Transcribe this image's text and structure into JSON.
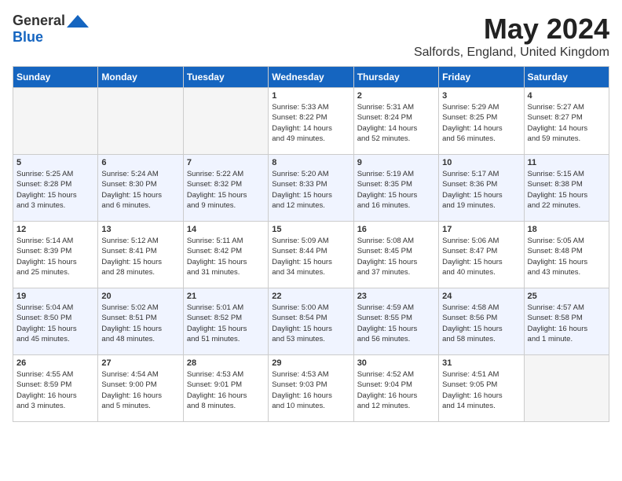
{
  "header": {
    "logo_general": "General",
    "logo_blue": "Blue",
    "month": "May 2024",
    "location": "Salfords, England, United Kingdom"
  },
  "days_of_week": [
    "Sunday",
    "Monday",
    "Tuesday",
    "Wednesday",
    "Thursday",
    "Friday",
    "Saturday"
  ],
  "weeks": [
    [
      {
        "day": "",
        "info": ""
      },
      {
        "day": "",
        "info": ""
      },
      {
        "day": "",
        "info": ""
      },
      {
        "day": "1",
        "info": "Sunrise: 5:33 AM\nSunset: 8:22 PM\nDaylight: 14 hours\nand 49 minutes."
      },
      {
        "day": "2",
        "info": "Sunrise: 5:31 AM\nSunset: 8:24 PM\nDaylight: 14 hours\nand 52 minutes."
      },
      {
        "day": "3",
        "info": "Sunrise: 5:29 AM\nSunset: 8:25 PM\nDaylight: 14 hours\nand 56 minutes."
      },
      {
        "day": "4",
        "info": "Sunrise: 5:27 AM\nSunset: 8:27 PM\nDaylight: 14 hours\nand 59 minutes."
      }
    ],
    [
      {
        "day": "5",
        "info": "Sunrise: 5:25 AM\nSunset: 8:28 PM\nDaylight: 15 hours\nand 3 minutes."
      },
      {
        "day": "6",
        "info": "Sunrise: 5:24 AM\nSunset: 8:30 PM\nDaylight: 15 hours\nand 6 minutes."
      },
      {
        "day": "7",
        "info": "Sunrise: 5:22 AM\nSunset: 8:32 PM\nDaylight: 15 hours\nand 9 minutes."
      },
      {
        "day": "8",
        "info": "Sunrise: 5:20 AM\nSunset: 8:33 PM\nDaylight: 15 hours\nand 12 minutes."
      },
      {
        "day": "9",
        "info": "Sunrise: 5:19 AM\nSunset: 8:35 PM\nDaylight: 15 hours\nand 16 minutes."
      },
      {
        "day": "10",
        "info": "Sunrise: 5:17 AM\nSunset: 8:36 PM\nDaylight: 15 hours\nand 19 minutes."
      },
      {
        "day": "11",
        "info": "Sunrise: 5:15 AM\nSunset: 8:38 PM\nDaylight: 15 hours\nand 22 minutes."
      }
    ],
    [
      {
        "day": "12",
        "info": "Sunrise: 5:14 AM\nSunset: 8:39 PM\nDaylight: 15 hours\nand 25 minutes."
      },
      {
        "day": "13",
        "info": "Sunrise: 5:12 AM\nSunset: 8:41 PM\nDaylight: 15 hours\nand 28 minutes."
      },
      {
        "day": "14",
        "info": "Sunrise: 5:11 AM\nSunset: 8:42 PM\nDaylight: 15 hours\nand 31 minutes."
      },
      {
        "day": "15",
        "info": "Sunrise: 5:09 AM\nSunset: 8:44 PM\nDaylight: 15 hours\nand 34 minutes."
      },
      {
        "day": "16",
        "info": "Sunrise: 5:08 AM\nSunset: 8:45 PM\nDaylight: 15 hours\nand 37 minutes."
      },
      {
        "day": "17",
        "info": "Sunrise: 5:06 AM\nSunset: 8:47 PM\nDaylight: 15 hours\nand 40 minutes."
      },
      {
        "day": "18",
        "info": "Sunrise: 5:05 AM\nSunset: 8:48 PM\nDaylight: 15 hours\nand 43 minutes."
      }
    ],
    [
      {
        "day": "19",
        "info": "Sunrise: 5:04 AM\nSunset: 8:50 PM\nDaylight: 15 hours\nand 45 minutes."
      },
      {
        "day": "20",
        "info": "Sunrise: 5:02 AM\nSunset: 8:51 PM\nDaylight: 15 hours\nand 48 minutes."
      },
      {
        "day": "21",
        "info": "Sunrise: 5:01 AM\nSunset: 8:52 PM\nDaylight: 15 hours\nand 51 minutes."
      },
      {
        "day": "22",
        "info": "Sunrise: 5:00 AM\nSunset: 8:54 PM\nDaylight: 15 hours\nand 53 minutes."
      },
      {
        "day": "23",
        "info": "Sunrise: 4:59 AM\nSunset: 8:55 PM\nDaylight: 15 hours\nand 56 minutes."
      },
      {
        "day": "24",
        "info": "Sunrise: 4:58 AM\nSunset: 8:56 PM\nDaylight: 15 hours\nand 58 minutes."
      },
      {
        "day": "25",
        "info": "Sunrise: 4:57 AM\nSunset: 8:58 PM\nDaylight: 16 hours\nand 1 minute."
      }
    ],
    [
      {
        "day": "26",
        "info": "Sunrise: 4:55 AM\nSunset: 8:59 PM\nDaylight: 16 hours\nand 3 minutes."
      },
      {
        "day": "27",
        "info": "Sunrise: 4:54 AM\nSunset: 9:00 PM\nDaylight: 16 hours\nand 5 minutes."
      },
      {
        "day": "28",
        "info": "Sunrise: 4:53 AM\nSunset: 9:01 PM\nDaylight: 16 hours\nand 8 minutes."
      },
      {
        "day": "29",
        "info": "Sunrise: 4:53 AM\nSunset: 9:03 PM\nDaylight: 16 hours\nand 10 minutes."
      },
      {
        "day": "30",
        "info": "Sunrise: 4:52 AM\nSunset: 9:04 PM\nDaylight: 16 hours\nand 12 minutes."
      },
      {
        "day": "31",
        "info": "Sunrise: 4:51 AM\nSunset: 9:05 PM\nDaylight: 16 hours\nand 14 minutes."
      },
      {
        "day": "",
        "info": ""
      }
    ]
  ]
}
